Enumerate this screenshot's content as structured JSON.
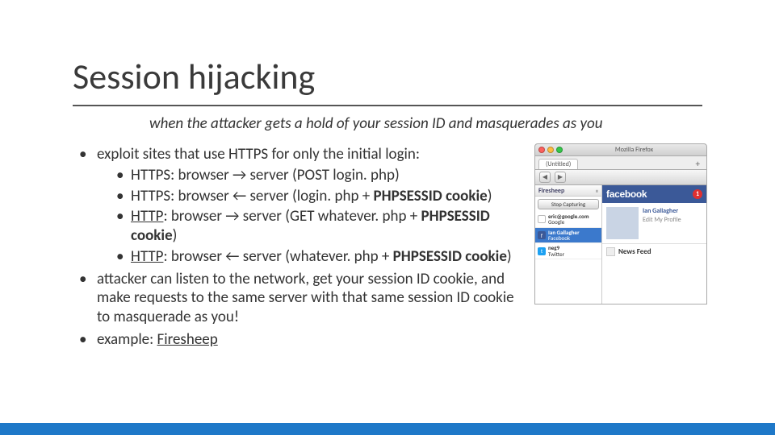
{
  "title": "Session hijacking",
  "subtitle": "when the attacker gets a hold of your session ID and masquerades as you",
  "bullets": {
    "b1": "exploit sites that use HTTPS for only the initial login:",
    "b1a": "HTTPS: browser → server (POST login. php)",
    "b1b_1": "HTTPS: browser ← server (login. php + ",
    "b1b_2": "PHPSESSID cookie",
    "b1b_3": ")",
    "b1c_1": "HTTP",
    "b1c_2": ": browser → server (GET whatever. php + ",
    "b1c_3": "PHPSESSID cookie",
    "b1c_4": ")",
    "b1d_1": "HTTP",
    "b1d_2": ": browser ← server (whatever. php + ",
    "b1d_3": "PHPSESSID cookie",
    "b1d_4": ")",
    "b2": "attacker can listen to the network, get your session ID cookie, and make requests to the same server with that same session ID cookie to masquerade as you!",
    "b3_1": "example: ",
    "b3_link": "Firesheep"
  },
  "screenshot": {
    "window_app": "Mozilla Firefox",
    "tab": "(Untitled)",
    "nav_back": "◀",
    "nav_fwd": "▶",
    "side_header": "Firesheep",
    "side_menu": "≡",
    "stop_btn": "Stop Capturing",
    "user1_name": "eric@google.com",
    "user1_service": "Google",
    "user2_name": "Ian Gallagher",
    "user2_service": "Facebook",
    "user3_name": "neg9",
    "user3_service": "Twitter",
    "fb_logo": "facebook",
    "fb_badge": "1",
    "profile_name": "Ian Gallagher",
    "profile_edit": "Edit My Profile",
    "feed_label": "News Feed"
  }
}
